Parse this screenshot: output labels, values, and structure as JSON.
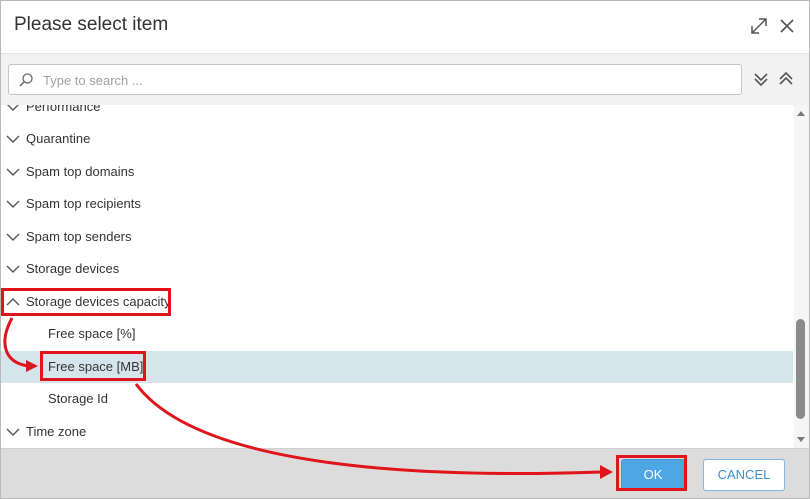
{
  "dialog": {
    "title": "Please select item",
    "maximize_icon": "expand-arrows-icon",
    "close_icon": "close-icon"
  },
  "search": {
    "placeholder": "Type to search ...",
    "value": "",
    "icon": "search-icon",
    "expand_all_icon": "double-chevron-down-icon",
    "collapse_all_icon": "double-chevron-up-icon"
  },
  "tree": {
    "items": [
      {
        "label": "Performance",
        "level": 0,
        "expanded": false
      },
      {
        "label": "Quarantine",
        "level": 0,
        "expanded": false
      },
      {
        "label": "Spam top domains",
        "level": 0,
        "expanded": false
      },
      {
        "label": "Spam top recipients",
        "level": 0,
        "expanded": false
      },
      {
        "label": "Spam top senders",
        "level": 0,
        "expanded": false
      },
      {
        "label": "Storage devices",
        "level": 0,
        "expanded": false
      },
      {
        "label": "Storage devices capacity",
        "level": 0,
        "expanded": true
      },
      {
        "label": "Free space [%]",
        "level": 1
      },
      {
        "label": "Free space [MB]",
        "level": 1,
        "selected": true
      },
      {
        "label": "Storage Id",
        "level": 1
      },
      {
        "label": "Time zone",
        "level": 0,
        "expanded": false
      }
    ]
  },
  "footer": {
    "ok_label": "OK",
    "cancel_label": "CANCEL"
  },
  "colors": {
    "selected_row": "#d6e5ec",
    "ok_button": "#4ea7e3",
    "annotation": "#e0141b"
  }
}
